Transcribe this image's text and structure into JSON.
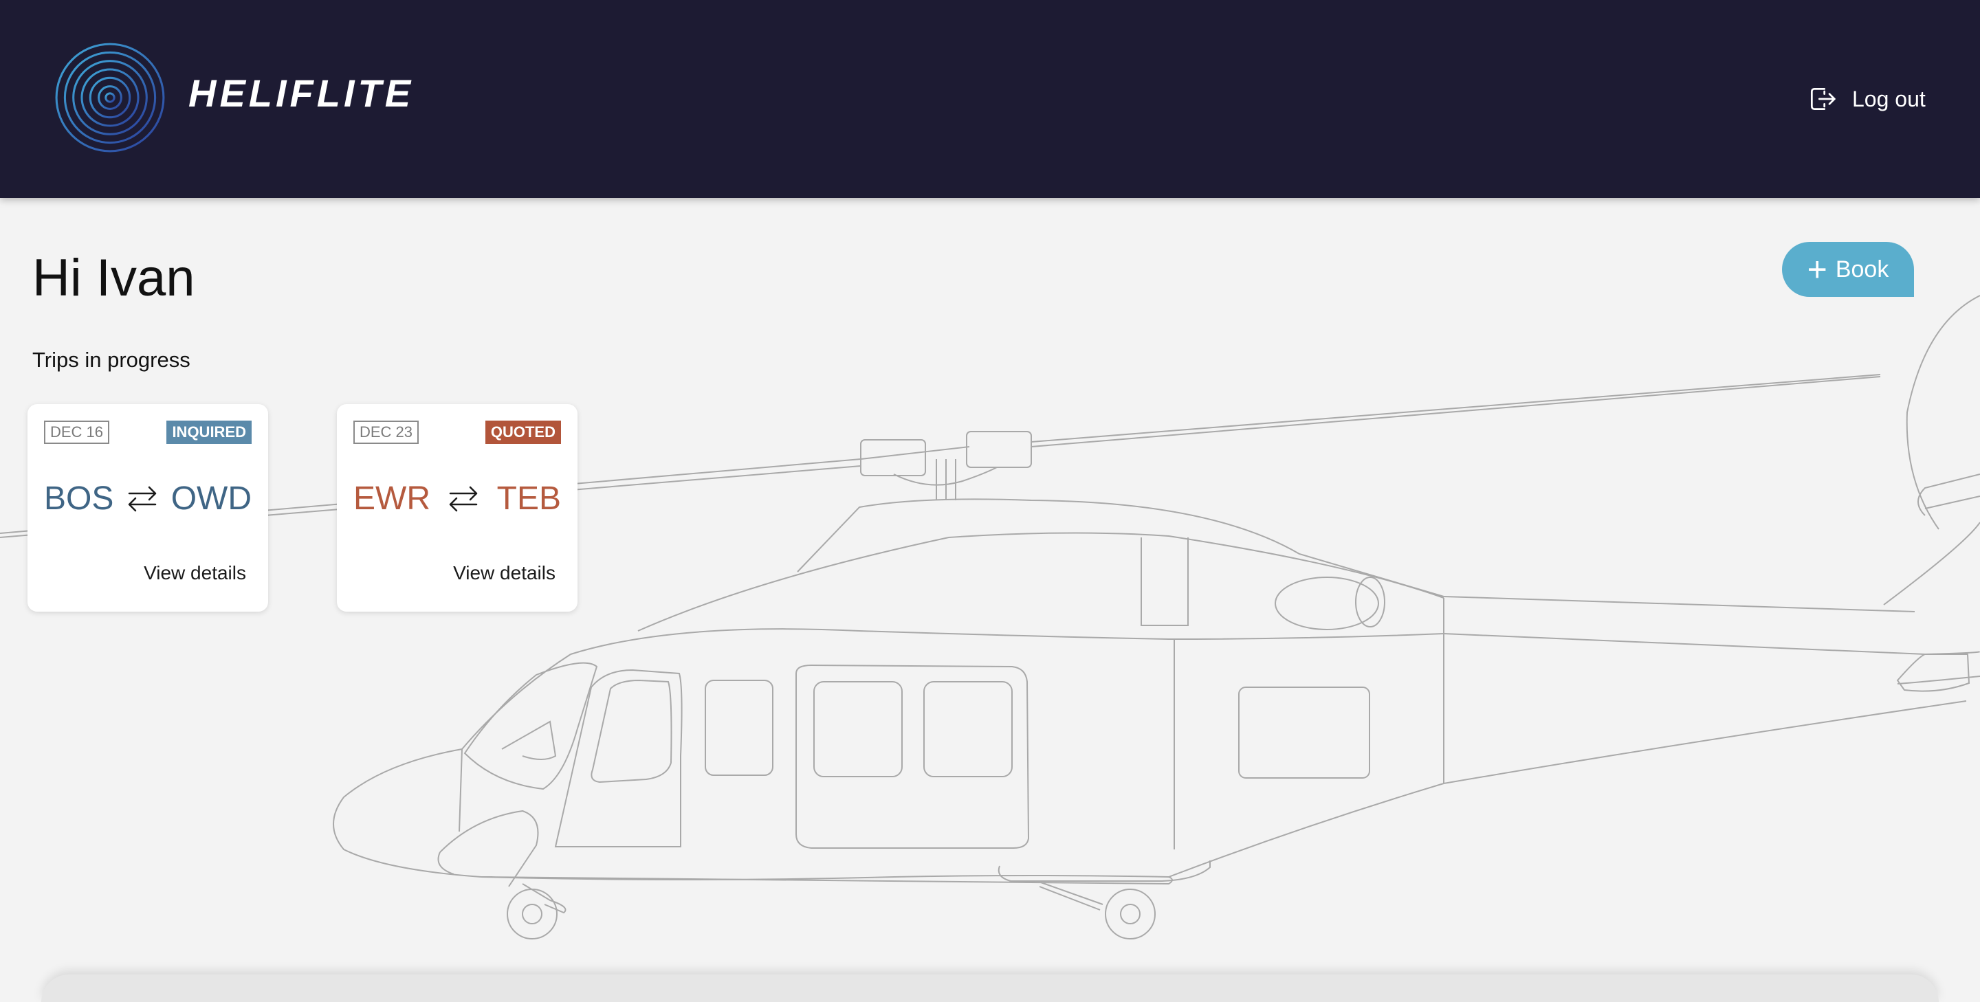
{
  "header": {
    "brand": "HELIFLITE",
    "logout_label": "Log out",
    "logo_icon": "concentric-rings-icon",
    "logout_icon": "logout-icon"
  },
  "main": {
    "greeting": "Hi Ivan",
    "book_label": "Book",
    "book_icon": "plus-icon",
    "section_title": "Trips in progress"
  },
  "trips": [
    {
      "date": "DEC 16",
      "status": "INQUIRED",
      "status_color": "#5b8aaa",
      "from": "BOS",
      "to": "OWD",
      "code_color": "#3f6585",
      "swap_icon": "swap-arrows-icon",
      "link": "View details"
    },
    {
      "date": "DEC 23",
      "status": "QUOTED",
      "status_color": "#b2553a",
      "from": "EWR",
      "to": "TEB",
      "code_color": "#b55a3e",
      "swap_icon": "swap-arrows-icon",
      "link": "View details"
    }
  ],
  "colors": {
    "header_bg": "#1d1b33",
    "page_bg": "#f3f3f3",
    "book_button": "#5aaecd",
    "illustration_stroke": "#a9a9a9"
  },
  "background_illustration": "helicopter-line-drawing"
}
